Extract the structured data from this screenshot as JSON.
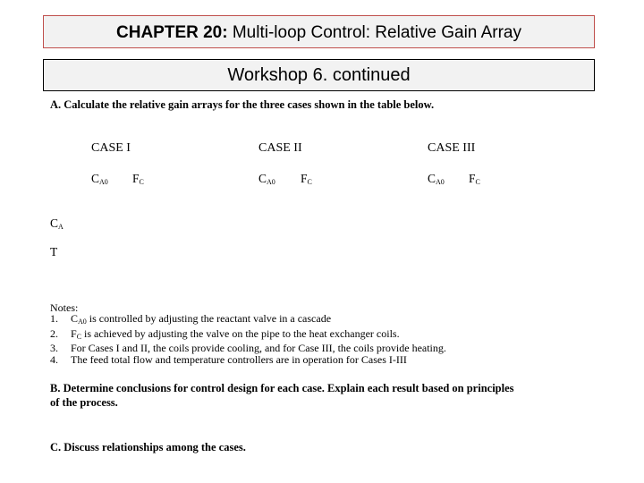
{
  "header": {
    "chapter_label": "CHAPTER 20:",
    "chapter_title": "Multi-loop Control: Relative Gain Array",
    "subtitle": "Workshop 6. continued"
  },
  "question_a": "A.  Calculate the relative gain arrays for the three cases shown in the table below.",
  "cases": [
    {
      "title": "CASE I",
      "col1": "C",
      "col1_sub": "A0",
      "col2": "F",
      "col2_sub": "C"
    },
    {
      "title": "CASE II",
      "col1": "C",
      "col1_sub": "A0",
      "col2": "F",
      "col2_sub": "C"
    },
    {
      "title": "CASE III",
      "col1": "C",
      "col1_sub": "A0",
      "col2": "F",
      "col2_sub": "C"
    }
  ],
  "rows": [
    {
      "label": "C",
      "sub": "A"
    },
    {
      "label": "T",
      "sub": ""
    }
  ],
  "notes": {
    "heading": "Notes:",
    "items": [
      {
        "num": "1.",
        "var": "C",
        "sub": "A0",
        "text": " is controlled by adjusting the reactant valve in a cascade"
      },
      {
        "num": "2.",
        "var": "F",
        "sub": "C",
        "text": " is achieved by adjusting the valve on the pipe to the heat exchanger coils."
      },
      {
        "num": "3.",
        "var": "",
        "sub": "",
        "text": "For Cases I and II, the coils provide cooling, and for Case III, the coils provide heating."
      },
      {
        "num": "4.",
        "var": "",
        "sub": "",
        "text": "The feed total flow and temperature controllers are in operation for Cases I-III"
      }
    ]
  },
  "question_b_line1": "B.  Determine conclusions for control design for each case.  Explain each result based on principles",
  "question_b_line2": "of the process.",
  "question_c": "C.  Discuss relationships among the cases."
}
